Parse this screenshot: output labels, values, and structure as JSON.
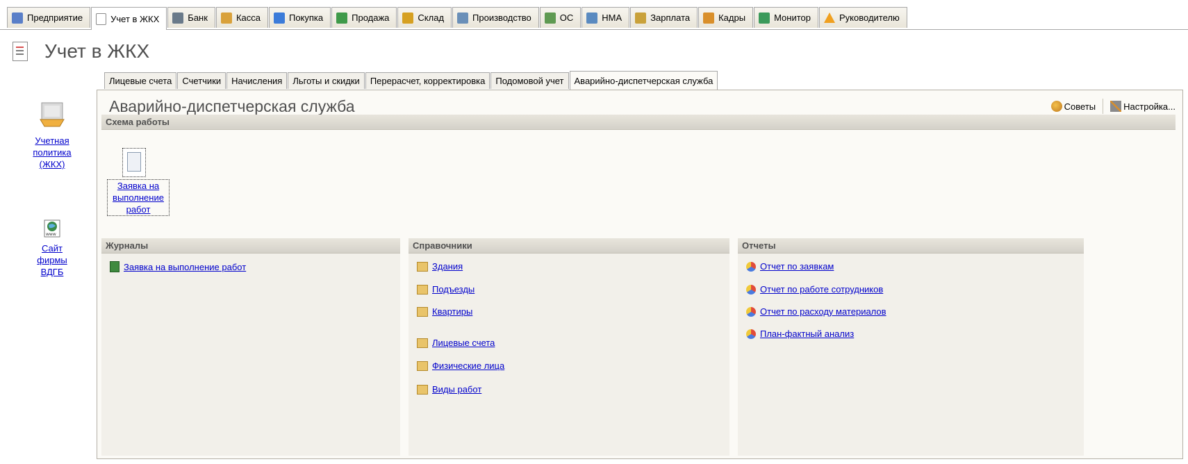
{
  "top_tabs": [
    {
      "label": "Предприятие",
      "icon": "enterprise-icon",
      "color": "#5a7fc8"
    },
    {
      "label": "Учет в ЖКХ",
      "icon": "housing-doc-icon",
      "color": "#9aa6b8",
      "active": true
    },
    {
      "label": "Банк",
      "icon": "bank-icon",
      "color": "#6a7a8a"
    },
    {
      "label": "Касса",
      "icon": "cash-icon",
      "color": "#d9a13b"
    },
    {
      "label": "Покупка",
      "icon": "purchase-icon",
      "color": "#3b7bd9"
    },
    {
      "label": "Продажа",
      "icon": "sale-icon",
      "color": "#3f9a4a"
    },
    {
      "label": "Склад",
      "icon": "warehouse-icon",
      "color": "#d6a021"
    },
    {
      "label": "Производство",
      "icon": "production-icon",
      "color": "#6a8fb8"
    },
    {
      "label": "ОС",
      "icon": "fixed-assets-icon",
      "color": "#5f9a52"
    },
    {
      "label": "НМА",
      "icon": "intangible-assets-icon",
      "color": "#5a8ac0"
    },
    {
      "label": "Зарплата",
      "icon": "salary-icon",
      "color": "#c9a13a"
    },
    {
      "label": "Кадры",
      "icon": "staff-icon",
      "color": "#d98f2b"
    },
    {
      "label": "Монитор",
      "icon": "monitor-icon",
      "color": "#3b9a5b"
    },
    {
      "label": "Руководителю",
      "icon": "warning-icon",
      "color": "#f0a020"
    }
  ],
  "page_title": "Учет в ЖКХ",
  "left_nav": [
    {
      "label": "Учетная политика (ЖКХ)",
      "icon": "accounting-policy-icon"
    },
    {
      "label": "Сайт фирмы ВДГБ",
      "icon": "website-globe-icon"
    }
  ],
  "sub_tabs": [
    {
      "label": "Лицевые счета"
    },
    {
      "label": "Счетчики"
    },
    {
      "label": "Начисления"
    },
    {
      "label": "Льготы и скидки"
    },
    {
      "label": "Перерасчет, корректировка"
    },
    {
      "label": "Подомовой учет"
    },
    {
      "label": "Аварийно-диспетчерская служба",
      "active": true
    }
  ],
  "panel": {
    "title": "Аварийно-диспетчерская служба",
    "tips_label": "Советы",
    "settings_label": "Настройка...",
    "scheme": {
      "header": "Схема работы",
      "item_label": "Заявка на выполнение работ"
    },
    "journals": {
      "header": "Журналы",
      "items": [
        "Заявка на выполнение работ"
      ]
    },
    "references": {
      "header": "Справочники",
      "items": [
        "Здания",
        "Подъезды",
        "Квартиры",
        "Лицевые счета",
        "Физические лица",
        "Виды работ"
      ]
    },
    "reports": {
      "header": "Отчеты",
      "items": [
        "Отчет по заявкам",
        "Отчет по работе сотрудников",
        "Отчет по расходу материалов",
        "План-фактный анализ"
      ]
    }
  }
}
